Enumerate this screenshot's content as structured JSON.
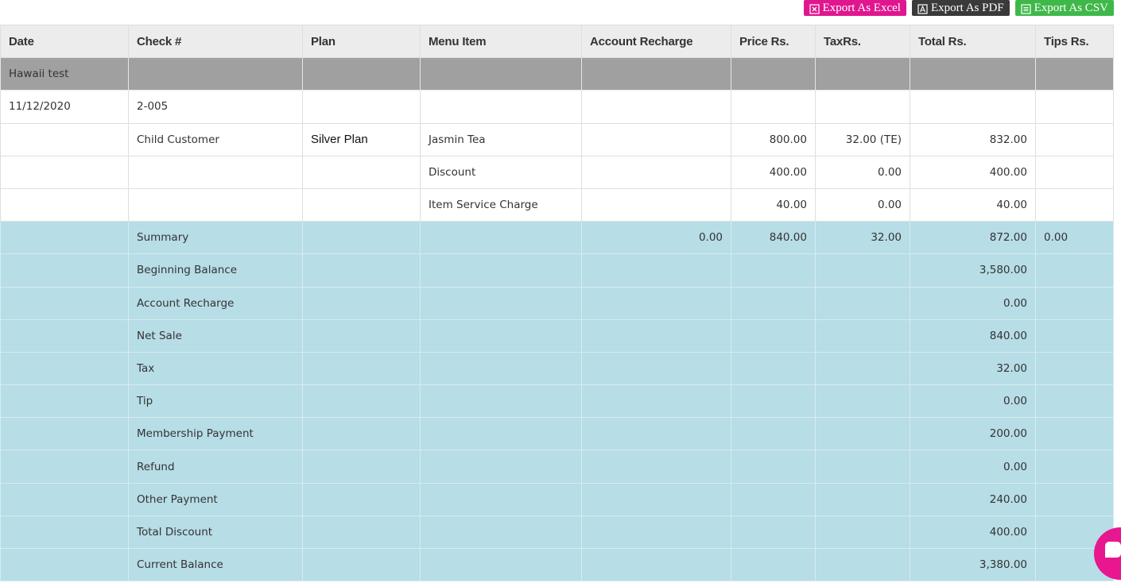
{
  "toolbar": {
    "export_excel_label": "Export As Excel",
    "export_pdf_label": "Export As PDF",
    "export_csv_label": "Export As CSV"
  },
  "colors": {
    "excel_button": "#e0168f",
    "pdf_button": "#3a3a3a",
    "csv_button": "#3fb84a",
    "group_row": "#a0a0a0",
    "summary_row": "#b7dde6",
    "chat_bubble": "#e8168f"
  },
  "icons": {
    "excel": "excel-file-icon",
    "pdf": "pdf-file-icon",
    "csv": "csv-file-icon",
    "chat": "chat-icon"
  },
  "table": {
    "columns": [
      "Date",
      "Check #",
      "Plan",
      "Menu Item",
      "Account Recharge",
      "Price Rs.",
      "TaxRs.",
      "Total Rs.",
      "Tips Rs."
    ],
    "group": {
      "name": "Hawaii test"
    },
    "check_row": {
      "date": "11/12/2020",
      "check": "2-005"
    },
    "items": [
      {
        "check": "Child Customer",
        "plan": "Silver Plan",
        "menu_item": "Jasmin Tea",
        "account_recharge": "",
        "price": "800.00",
        "tax": "32.00 (TE)",
        "total": "832.00",
        "tips": ""
      },
      {
        "check": "",
        "plan": "",
        "menu_item": "Discount",
        "account_recharge": "",
        "price": "400.00",
        "tax": "0.00",
        "total": "400.00",
        "tips": ""
      },
      {
        "check": "",
        "plan": "",
        "menu_item": "Item Service Charge",
        "account_recharge": "",
        "price": "40.00",
        "tax": "0.00",
        "total": "40.00",
        "tips": ""
      }
    ],
    "summary": {
      "label": "Summary",
      "account_recharge": "0.00",
      "price": "840.00",
      "tax": "32.00",
      "total": "872.00",
      "tips": "0.00"
    },
    "balances": [
      {
        "label": "Beginning Balance",
        "value": "3,580.00"
      },
      {
        "label": "Account Recharge",
        "value": "0.00"
      },
      {
        "label": "Net Sale",
        "value": "840.00"
      },
      {
        "label": "Tax",
        "value": "32.00"
      },
      {
        "label": "Tip",
        "value": "0.00"
      },
      {
        "label": "Membership Payment",
        "value": "200.00"
      },
      {
        "label": "Refund",
        "value": "0.00"
      },
      {
        "label": "Other Payment",
        "value": "240.00"
      },
      {
        "label": "Total Discount",
        "value": "400.00"
      },
      {
        "label": "Current Balance",
        "value": "3,380.00"
      }
    ]
  }
}
